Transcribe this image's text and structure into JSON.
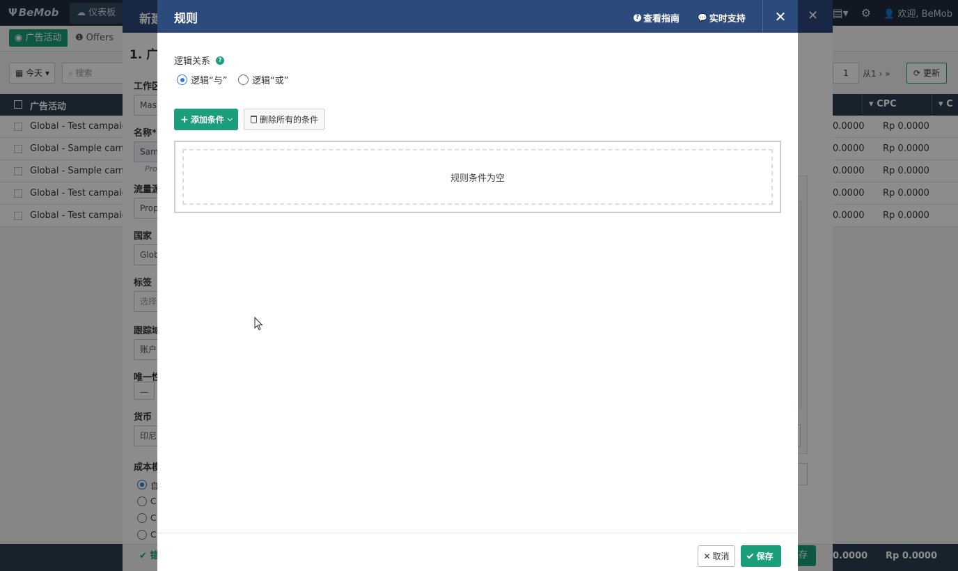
{
  "app": {
    "brand": "BeMob",
    "dashboard_tab": "仪表板",
    "welcome": "欢迎, BeMob"
  },
  "subbar": {
    "campaigns_tab": "广告活动",
    "offers_tab": "Offers"
  },
  "toolbar": {
    "date_filter": "今天",
    "search_placeholder": "搜索",
    "page_number": "1",
    "page_of": "从1",
    "refresh_label": "更新"
  },
  "grid": {
    "header_name": "广告活动",
    "header_cpc": "CPC",
    "header_next": "C",
    "rows": [
      {
        "name": "Global - Test campaign",
        "v1": "0.0000",
        "v2": "Rp 0.0000"
      },
      {
        "name": "Global - Sample campai",
        "v1": "0.0000",
        "v2": "Rp 0.0000"
      },
      {
        "name": "Global - Sample campai",
        "v1": "0.0000",
        "v2": "Rp 0.0000"
      },
      {
        "name": "Global - Test campaign",
        "v1": "0.0000",
        "v2": "Rp 0.0000"
      },
      {
        "name": "Global - Test campaign",
        "v1": "0.0000",
        "v2": "Rp 0.0000"
      }
    ],
    "footer_v1": "0.0000",
    "footer_v2": "Rp 0.0000"
  },
  "side_panel": {
    "title": "新建",
    "section": "1. 广",
    "fields": [
      {
        "label": "工作区",
        "value": "Mast"
      },
      {
        "label": "名称*",
        "value": "Samp",
        "hint": "Prop"
      },
      {
        "label": "流量源",
        "value": "Prop"
      },
      {
        "label": "国家",
        "value": "Glob"
      },
      {
        "label": "标签",
        "value": "选择"
      },
      {
        "label": "跟踪域",
        "value": "账户"
      },
      {
        "label": "唯一性",
        "value": "—"
      },
      {
        "label": "货币",
        "value": "印尼"
      }
    ],
    "cost_model_label": "成本模",
    "cost_model_options": [
      "自",
      "C",
      "C",
      "C"
    ],
    "error_text": "错",
    "save_label": "保存"
  },
  "modal": {
    "title": "规则",
    "guide_label": "查看指南",
    "support_label": "实时支持",
    "logic_label": "逻辑关系",
    "logic_options": [
      {
        "label": "逻辑“与”",
        "selected": true
      },
      {
        "label": "逻辑“或”",
        "selected": false
      }
    ],
    "add_condition_label": "添加条件",
    "delete_all_label": "删除所有的条件",
    "empty_text": "规则条件为空",
    "cancel_label": "取消",
    "save_label": "保存"
  },
  "colors": {
    "accent_green": "#1a9e7b",
    "header_blue": "#2c4a7c",
    "radio_blue": "#2d7ad6"
  }
}
